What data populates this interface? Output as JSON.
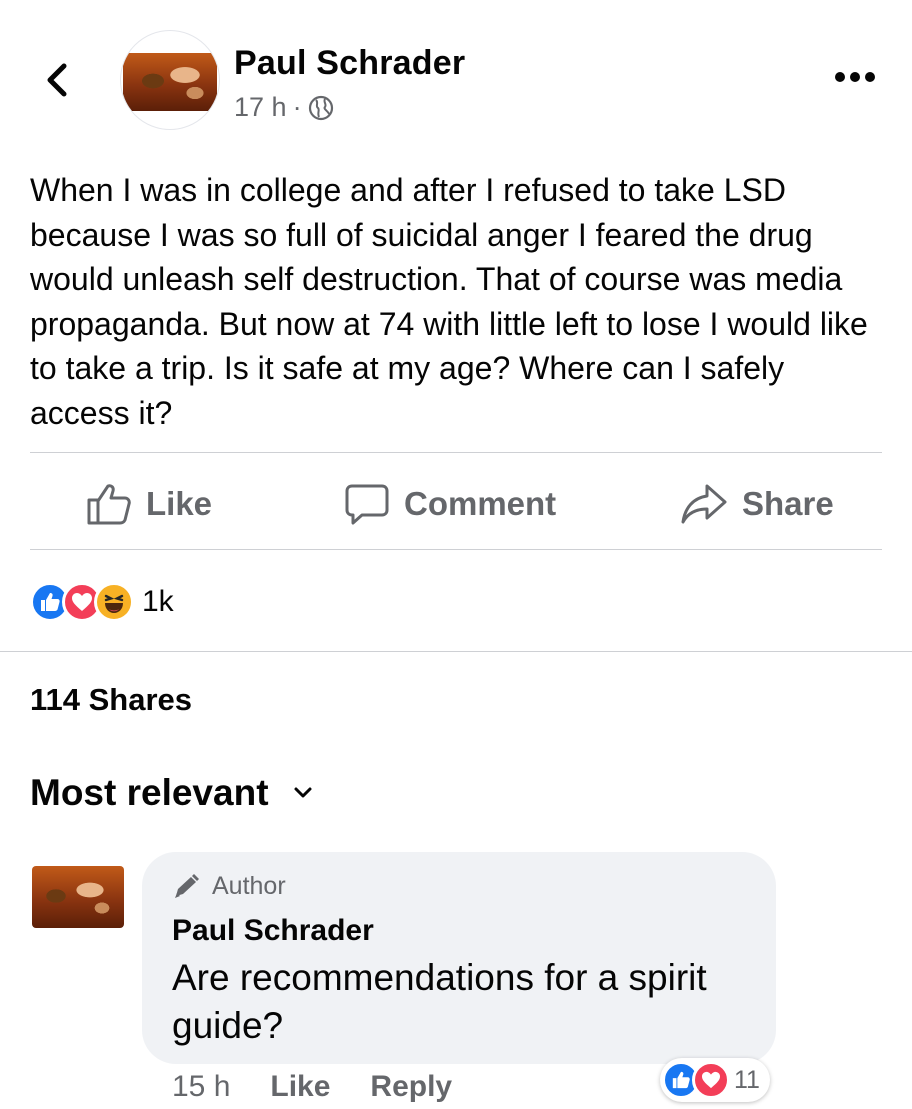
{
  "post": {
    "author": "Paul Schrader",
    "time": "17 h",
    "separator": "·",
    "text": "When I was in college and after I refused to take LSD because I was so full of suicidal anger I feared the drug would unleash self destruction. That of course was media propaganda. But now at 74 with little left to lose I would like to take a trip. Is it safe at my age? Where can I safely access it?"
  },
  "actions": {
    "like": "Like",
    "comment": "Comment",
    "share": "Share"
  },
  "reactions": {
    "count": "1k",
    "types": [
      "like-icon",
      "love-icon",
      "haha-icon"
    ]
  },
  "shares": "114 Shares",
  "sort": {
    "label": "Most relevant"
  },
  "comment": {
    "badge": "Author",
    "name": "Paul Schrader",
    "text": "Are recommendations for a spirit guide?",
    "time": "15 h",
    "like": "Like",
    "reply": "Reply",
    "reaction_count": "11",
    "reaction_types": [
      "like-icon",
      "love-icon"
    ]
  },
  "colors": {
    "text": "#050505",
    "secondary": "#65676b",
    "divider": "#ced0d4",
    "bubble": "#f0f2f5",
    "like_blue": "#1877f2",
    "love_red": "#f33e58",
    "haha_yellow": "#f7b125"
  }
}
